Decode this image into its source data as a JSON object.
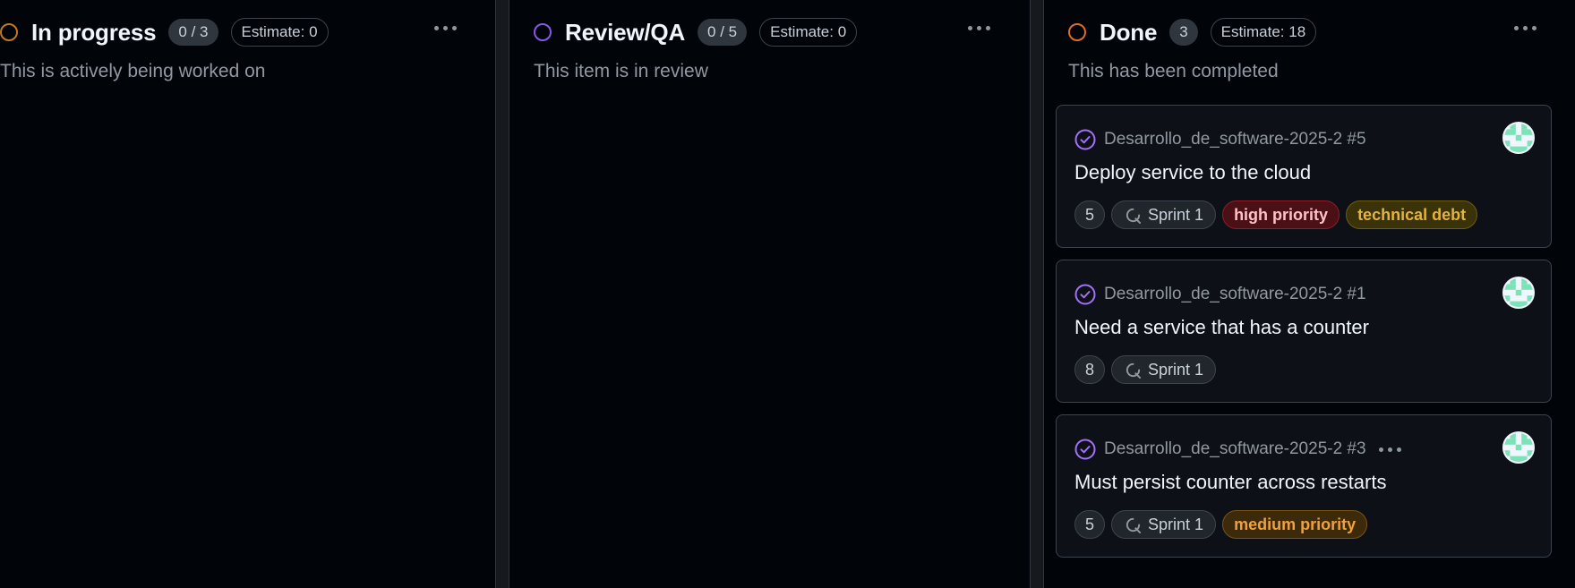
{
  "columns": [
    {
      "title": "In progress",
      "count": "0 / 3",
      "estimate": "Estimate: 0",
      "description": "This is actively being worked on",
      "status_color": "#c2791a"
    },
    {
      "title": "Review/QA",
      "count": "0 / 5",
      "estimate": "Estimate: 0",
      "description": "This item is in review",
      "status_color": "#8957e5"
    },
    {
      "title": "Done",
      "count": "3",
      "estimate": "Estimate: 18",
      "description": "This has been completed",
      "status_color": "#db6d28",
      "cards": [
        {
          "ref": "Desarrollo_de_software-2025-2 #5",
          "title": "Deploy service to the cloud",
          "estimate": "5",
          "sprint": "Sprint 1",
          "labels": [
            {
              "name": "high priority",
              "bg": "#4b1015",
              "border": "#8e1e26",
              "color": "#ffc1c5"
            },
            {
              "name": "technical debt",
              "bg": "#3a3208",
              "border": "#6f5c10",
              "color": "#e3b341"
            }
          ]
        },
        {
          "ref": "Desarrollo_de_software-2025-2 #1",
          "title": "Need a service that has a counter",
          "estimate": "8",
          "sprint": "Sprint 1",
          "labels": []
        },
        {
          "ref": "Desarrollo_de_software-2025-2 #3",
          "title": "Must persist counter across restarts",
          "estimate": "5",
          "sprint": "Sprint 1",
          "labels": [
            {
              "name": "medium priority",
              "bg": "#3d2a0a",
              "border": "#7a5315",
              "color": "#f0a13b"
            }
          ]
        }
      ]
    }
  ],
  "icons": {
    "closed_issue": "check-circle-icon",
    "sprint": "iteration-icon",
    "more": "kebab-horizontal-icon",
    "avatar": "identicon-avatar"
  },
  "colors": {
    "closed_purple": "#a371f7",
    "avatar_green": "#7ee2b8"
  }
}
